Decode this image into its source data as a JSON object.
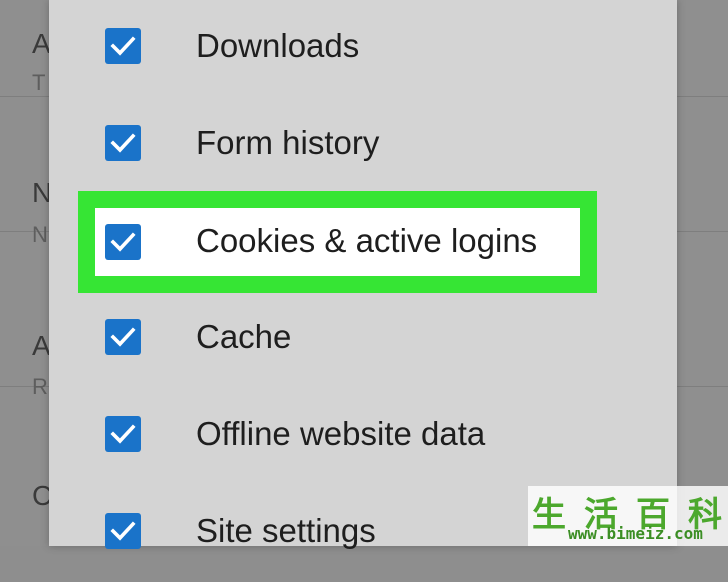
{
  "background_list": {
    "items": [
      {
        "title": "A",
        "subtitle": "T"
      },
      {
        "title": "N",
        "subtitle": "N"
      },
      {
        "title": "A",
        "subtitle": "R"
      },
      {
        "title": "C",
        "subtitle": ""
      }
    ]
  },
  "dialog": {
    "options": [
      {
        "label": "Downloads",
        "checked": true
      },
      {
        "label": "Form history",
        "checked": true
      },
      {
        "label": "Cookies & active logins",
        "checked": true
      },
      {
        "label": "Cache",
        "checked": true
      },
      {
        "label": "Offline website data",
        "checked": true
      },
      {
        "label": "Site settings",
        "checked": true
      }
    ],
    "highlighted_option": "Cookies & active logins"
  },
  "colors": {
    "checkbox": "#1a73c9",
    "highlight": "#36e534",
    "dialog_bg": "#d4d4d4"
  },
  "watermark": {
    "chars": [
      "生",
      "活",
      "百",
      "科"
    ],
    "url": "www.bimeiz.com"
  }
}
